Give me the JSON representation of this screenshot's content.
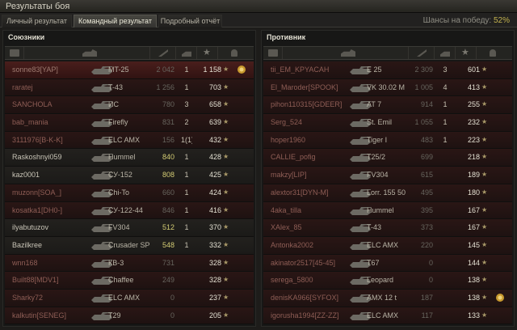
{
  "window": {
    "title": "Результаты боя"
  },
  "tabs": [
    "Личный результат",
    "Командный результат",
    "Подробный отчёт"
  ],
  "active_tab": 1,
  "win_chance": {
    "label": "Шансы на победу:",
    "value": "52%"
  },
  "allies": {
    "title": "Союзники",
    "rows": [
      {
        "name": "sonne83[YAP]",
        "tank": "MT-25",
        "dmg": "2 042",
        "kills": "1",
        "xp": "1 158",
        "state": "me",
        "badge": "medal"
      },
      {
        "name": "raratej",
        "tank": "T-43",
        "dmg": "1 256",
        "kills": "1",
        "xp": "703",
        "state": "dead"
      },
      {
        "name": "SANCHOLA",
        "tank": "ИС",
        "dmg": "780",
        "kills": "3",
        "xp": "658",
        "state": "dead"
      },
      {
        "name": "bab_mania",
        "tank": "Firefly",
        "dmg": "831",
        "kills": "2",
        "xp": "639",
        "state": "dead"
      },
      {
        "name": "3111976[B-K-K]",
        "tank": "ELC AMX",
        "dmg": "156",
        "kills": "1(1)",
        "xp": "432",
        "state": "dead"
      },
      {
        "name": "Raskoshnyi059",
        "tank": "Hummel",
        "dmg": "840",
        "kills": "1",
        "xp": "428",
        "state": "alive"
      },
      {
        "name": "kaz0001",
        "tank": "СУ-152",
        "dmg": "808",
        "kills": "1",
        "xp": "425",
        "state": "alive"
      },
      {
        "name": "muzonn[SOA_]",
        "tank": "Chi-To",
        "dmg": "660",
        "kills": "1",
        "xp": "424",
        "state": "dead"
      },
      {
        "name": "kosatka1[DH0-]",
        "tank": "СУ-122-44",
        "dmg": "846",
        "kills": "1",
        "xp": "416",
        "state": "dead"
      },
      {
        "name": "ilyabutuzov",
        "tank": "FV304",
        "dmg": "512",
        "kills": "1",
        "xp": "370",
        "state": "alive"
      },
      {
        "name": "Bazilkree",
        "tank": "Crusader SP",
        "dmg": "548",
        "kills": "1",
        "xp": "332",
        "state": "alive"
      },
      {
        "name": "wnn168",
        "tank": "КВ-3",
        "dmg": "731",
        "kills": "",
        "xp": "328",
        "state": "dead"
      },
      {
        "name": "Built88[MDV1]",
        "tank": "Chaffee",
        "dmg": "249",
        "kills": "",
        "xp": "328",
        "state": "dead"
      },
      {
        "name": "Sharky72",
        "tank": "ELC AMX",
        "dmg": "0",
        "kills": "",
        "xp": "237",
        "state": "dead"
      },
      {
        "name": "kalkutin[SENEG]",
        "tank": "T29",
        "dmg": "0",
        "kills": "",
        "xp": "205",
        "state": "dead"
      }
    ]
  },
  "enemies": {
    "title": "Противник",
    "rows": [
      {
        "name": "tii_EM_KPYACAH",
        "tank": "E 25",
        "dmg": "2 309",
        "kills": "3",
        "xp": "601",
        "state": "dead"
      },
      {
        "name": "El_Maroder[SPOOK]",
        "tank": "VK 30.02 M",
        "dmg": "1 005",
        "kills": "4",
        "xp": "413",
        "state": "dead"
      },
      {
        "name": "pihon110315[GDEER]",
        "tank": "AT 7",
        "dmg": "914",
        "kills": "1",
        "xp": "255",
        "state": "dead"
      },
      {
        "name": "Serg_524",
        "tank": "St. Emil",
        "dmg": "1 055",
        "kills": "1",
        "xp": "232",
        "state": "dead"
      },
      {
        "name": "hoper1960",
        "tank": "Tiger I",
        "dmg": "483",
        "kills": "1",
        "xp": "223",
        "state": "dead"
      },
      {
        "name": "CALLIE_pofig",
        "tank": "T25/2",
        "dmg": "699",
        "kills": "",
        "xp": "218",
        "state": "dead"
      },
      {
        "name": "makzy[LIP]",
        "tank": "FV304",
        "dmg": "615",
        "kills": "",
        "xp": "189",
        "state": "dead"
      },
      {
        "name": "alextor31[DYN-M]",
        "tank": "Lorr. 155 50",
        "dmg": "495",
        "kills": "",
        "xp": "180",
        "state": "dead"
      },
      {
        "name": "4aka_tilla",
        "tank": "Hummel",
        "dmg": "395",
        "kills": "",
        "xp": "167",
        "state": "dead"
      },
      {
        "name": "XAlex_85",
        "tank": "T-43",
        "dmg": "373",
        "kills": "",
        "xp": "167",
        "state": "dead"
      },
      {
        "name": "Antonka2002",
        "tank": "ELC AMX",
        "dmg": "220",
        "kills": "",
        "xp": "145",
        "state": "dead"
      },
      {
        "name": "akinator2517[45-45]",
        "tank": "T67",
        "dmg": "0",
        "kills": "",
        "xp": "144",
        "state": "dead"
      },
      {
        "name": "serega_5800",
        "tank": "Leopard",
        "dmg": "0",
        "kills": "",
        "xp": "138",
        "state": "dead"
      },
      {
        "name": "denisKA966[SYFOX]",
        "tank": "AMX 12 t",
        "dmg": "187",
        "kills": "",
        "xp": "138",
        "state": "dead",
        "badge": "medal"
      },
      {
        "name": "igorusha1994[ZZ-ZZ]",
        "tank": "ELC AMX",
        "dmg": "117",
        "kills": "",
        "xp": "133",
        "state": "dead"
      }
    ]
  },
  "colors": {
    "accent": "#c3b24e",
    "alive_damage": "#d3cc74",
    "dead_row": "#2a1615",
    "highlight_row": "#4a1e1c"
  }
}
